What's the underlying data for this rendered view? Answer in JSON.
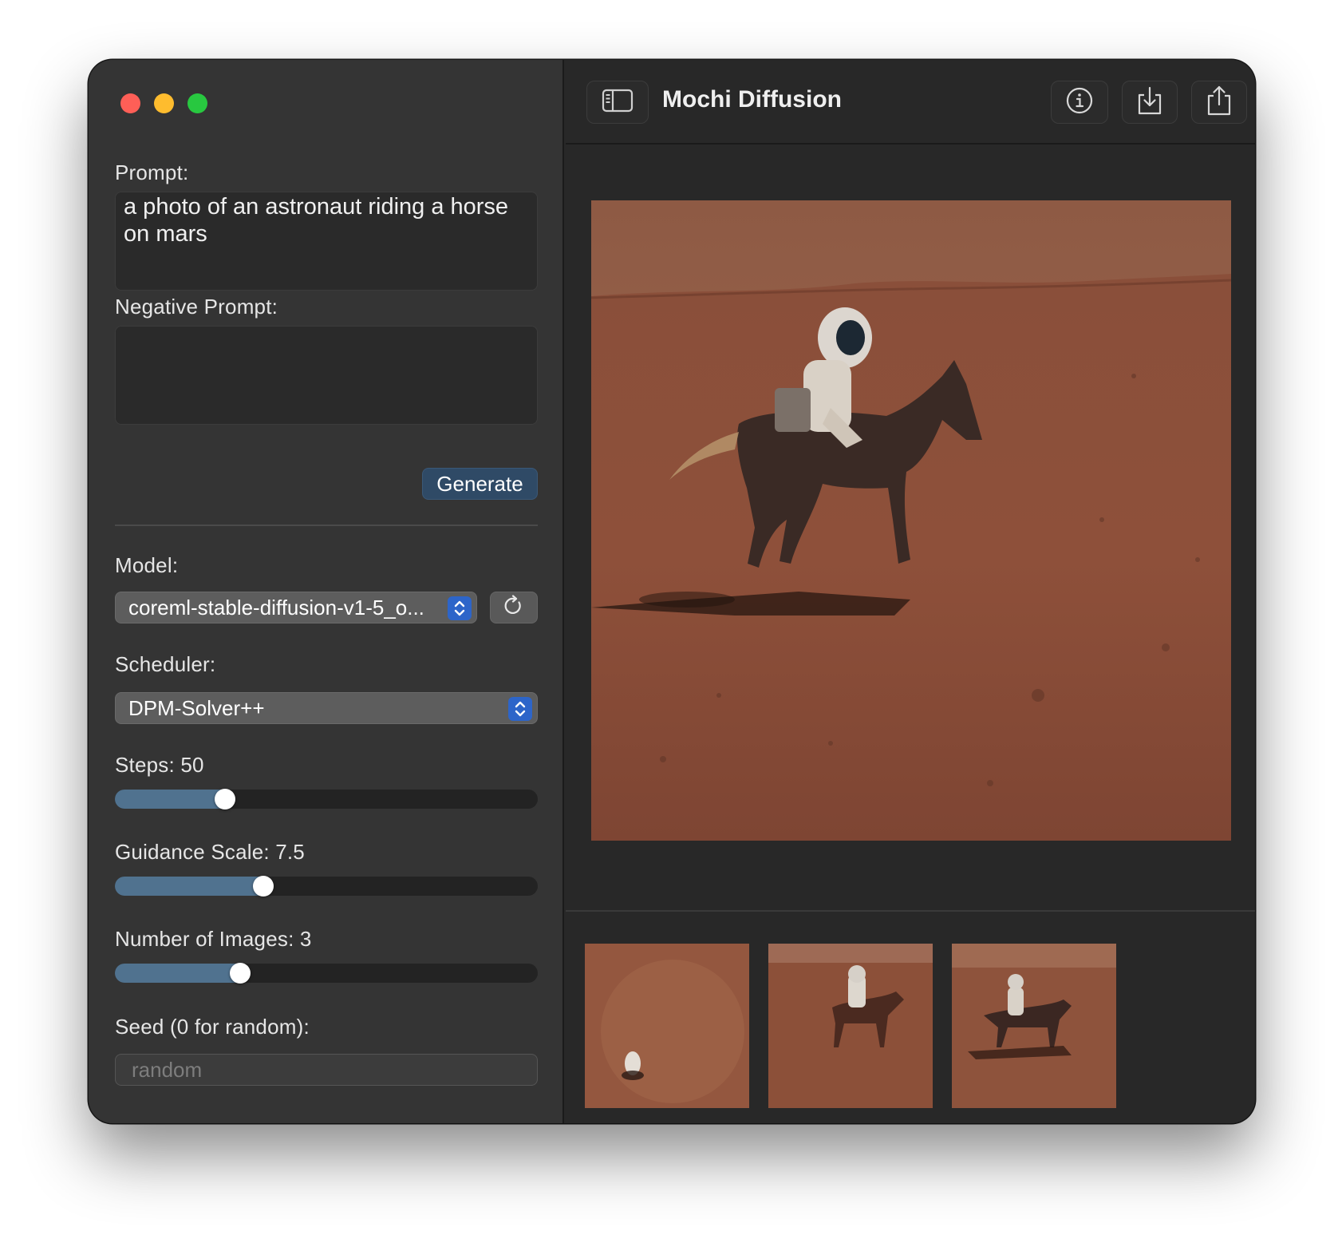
{
  "window": {
    "title": "Mochi Diffusion"
  },
  "sidebar": {
    "prompt_label": "Prompt:",
    "prompt_value": "a photo of an astronaut riding a horse on mars",
    "negative_prompt_label": "Negative Prompt:",
    "negative_prompt_value": "",
    "generate_label": "Generate",
    "model_label": "Model:",
    "model_value": "coreml-stable-diffusion-v1-5_o...",
    "scheduler_label": "Scheduler:",
    "scheduler_value": "DPM-Solver++",
    "steps_label": "Steps: 50",
    "steps_value": 50,
    "steps_fill_fraction": 0.26,
    "guidance_label": "Guidance Scale: 7.5",
    "guidance_value": 7.5,
    "guidance_fill_fraction": 0.35,
    "images_label": "Number of Images: 3",
    "images_value": 3,
    "images_fill_fraction": 0.296,
    "seed_label": "Seed (0 for random):",
    "seed_placeholder": "random"
  },
  "toolbar": {
    "icons": [
      "sidebar-toggle-icon",
      "info-icon",
      "download-icon",
      "share-icon"
    ]
  },
  "colors": {
    "accent": "#2d65c9",
    "slider_fill": "#50728f",
    "generate_button": "#2f4a66"
  }
}
